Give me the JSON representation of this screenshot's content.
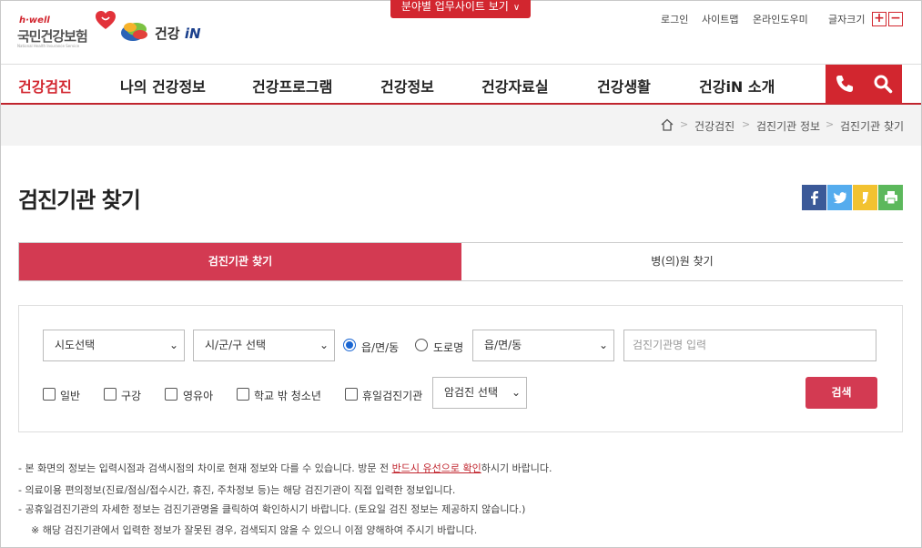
{
  "header": {
    "hwell": "h·well",
    "org_name": "국민건강보험",
    "org_sub": "National Health Insurance Service",
    "service_name_prefix": "건강",
    "service_name_suffix": "iN",
    "site_button": "분야별 업무사이트 보기",
    "util": [
      "로그인",
      "사이트맵",
      "온라인도우미"
    ],
    "font_size_label": "글자크기",
    "font_plus": "+",
    "font_minus": "−"
  },
  "gnb": {
    "items": [
      "건강검진",
      "나의 건강정보",
      "건강프로그램",
      "건강정보",
      "건강자료실",
      "건강생활",
      "건강iN 소개"
    ]
  },
  "breadcrumb": [
    "건강검진",
    "검진기관 정보",
    "검진기관 찾기"
  ],
  "page": {
    "title": "검진기관 찾기"
  },
  "tabs": [
    "검진기관 찾기",
    "병(의)원 찾기"
  ],
  "search": {
    "sido": "시도선택",
    "sigungu": "시/군/구 선택",
    "radio_1": "읍/면/동",
    "radio_2": "도로명",
    "dong": "읍/면/동",
    "name_placeholder": "검진기관명 입력",
    "checks": [
      "일반",
      "구강",
      "영유아",
      "학교 밖 청소년",
      "휴일검진기관"
    ],
    "cancer": "암검진 선택",
    "button": "검색"
  },
  "notes": {
    "line1_a": "- 본 화면의 정보는 입력시점과 검색시점의 차이로 현재 정보와 다를 수 있습니다.  방문 전 ",
    "line1_hl": "반드시 유선으로 확인",
    "line1_b": "하시기 바랍니다.",
    "line2": "- 의료이용 편의정보(진료/점심/접수시간, 휴진, 주차정보 등)는 해당 검진기관이 직접 입력한 정보입니다.",
    "line3": "- 공휴일검진기관의 자세한 정보는 검진기관명을 클릭하여 확인하시기 바랍니다. (토요일 검진 정보는 제공하지 않습니다.)",
    "line4": "※ 해당 검진기관에서 입력한 정보가 잘못된 경우, 검색되지 않을 수 있으니 이점 양해하여 주시기 바랍니다."
  },
  "colors": {
    "brand_red": "#d2262f",
    "tab_active": "#d33a52",
    "facebook": "#3b5998",
    "twitter": "#55acee",
    "kakao": "#f2c230",
    "print": "#5cb85c"
  },
  "icons": [
    "heart-logo-icon",
    "leaf-logo-icon",
    "phone-icon",
    "search-icon",
    "home-icon",
    "facebook-icon",
    "twitter-icon",
    "kakao-icon",
    "print-icon"
  ]
}
